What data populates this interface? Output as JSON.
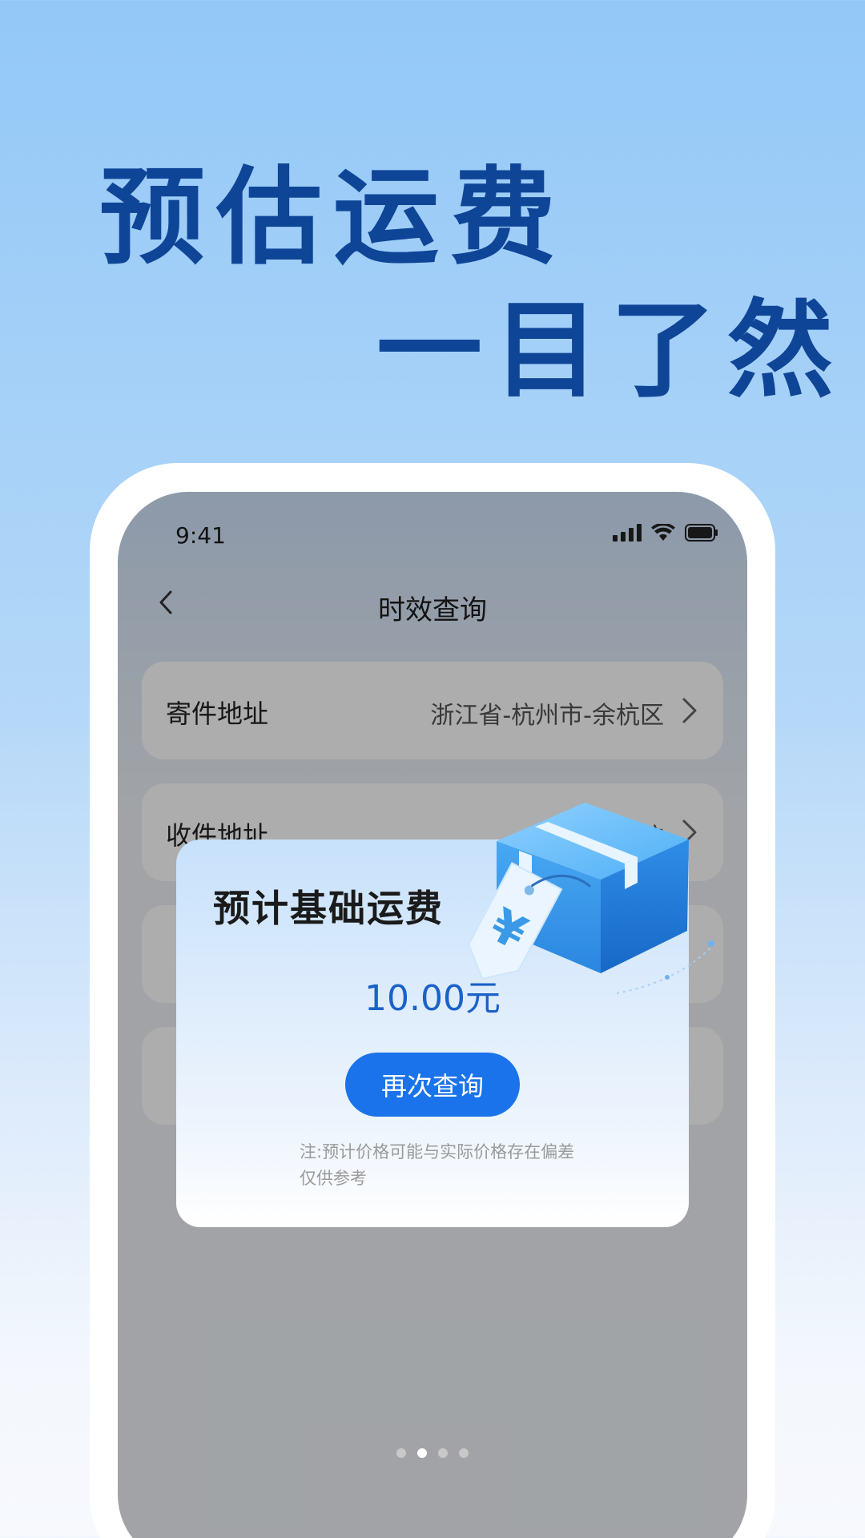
{
  "headline": {
    "line1": "预估运费",
    "line2": "一目了然"
  },
  "status_bar": {
    "time": "9:41"
  },
  "nav": {
    "title": "时效查询"
  },
  "form": {
    "rows": [
      {
        "label": "寄件地址",
        "value": "浙江省-杭州市-余杭区"
      },
      {
        "label": "收件地址",
        "value": "浙江省-杭"
      }
    ]
  },
  "modal": {
    "title": "预计基础运费",
    "price": "10.00元",
    "button_label": "再次查询",
    "note": "注:预计价格可能与实际价格存在偏差仅供参考"
  },
  "illustration": {
    "tag_symbol": "¥"
  },
  "pagination": {
    "count": 4,
    "active_index": 1
  },
  "colors": {
    "headline": "#0f4597",
    "primary_button": "#1a73ea",
    "price": "#1b61c9"
  }
}
